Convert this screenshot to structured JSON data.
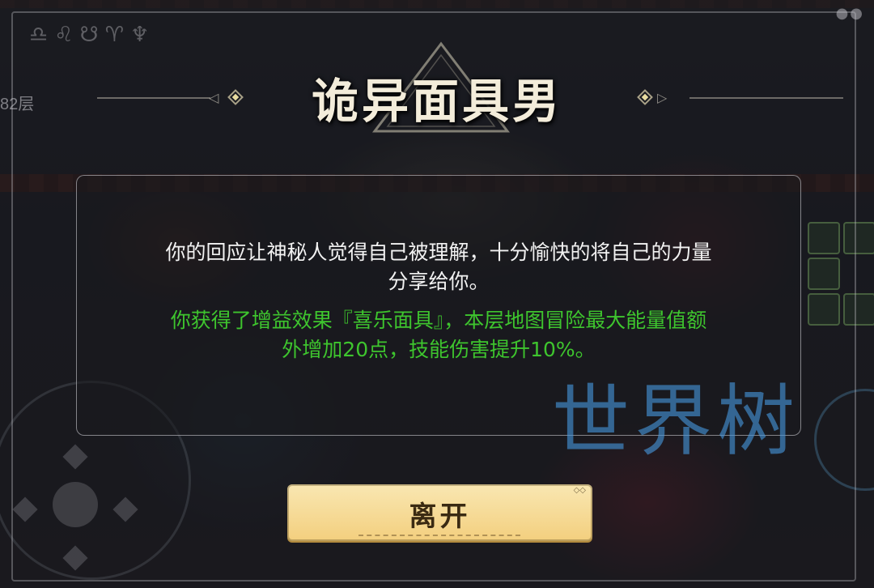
{
  "event": {
    "title": "诡异面具男",
    "floor_label": "82层",
    "description_lines": [
      "你的回应让神秘人觉得自己被理解，十分愉快的将自己的力量",
      "分享给你。"
    ],
    "reward_lines": [
      "你获得了增益效果『喜乐面具』，本层地图冒险最大能量值额",
      "外增加20点，技能伤害提升10%。"
    ]
  },
  "actions": {
    "leave_label": "离开"
  },
  "watermark": "世界树",
  "colors": {
    "title": "#f3ecda",
    "description": "#f2f2f2",
    "reward": "#3ec52e",
    "button": "#f3cf7e",
    "watermark": "#4696dc"
  }
}
